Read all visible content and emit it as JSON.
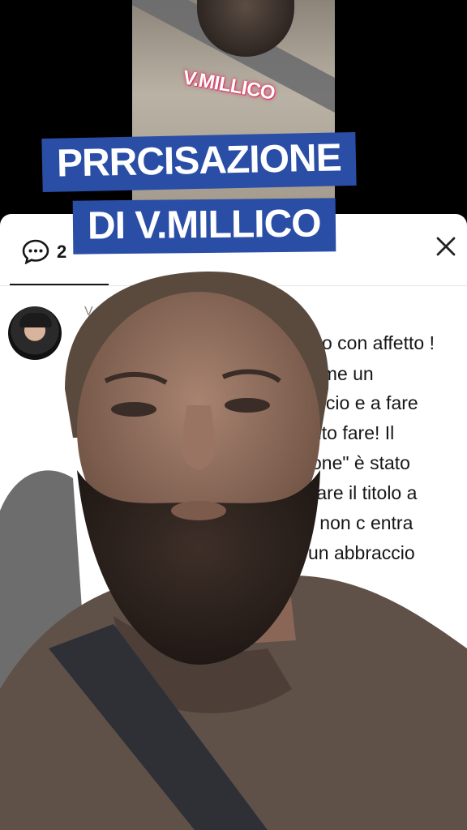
{
  "overlay": {
    "watermark": "V.MILLICO",
    "title_line1": "PRRCISAZIONE",
    "title_line2": "DI V.MILLICO"
  },
  "comments_sheet": {
    "count": "2",
    "username": "V",
    "comment_lines": [
      "o con affetto !",
      "ome un",
      "alcio e a fare",
      "uto fare! Il",
      "one\" è stato",
      "fare il titolo a",
      "di non c entra",
      "un abbraccio"
    ],
    "icons": {
      "comments": "speech-bubble-icon",
      "close": "close-icon"
    }
  },
  "colors": {
    "title_background": "#2a4ea6",
    "watermark_glow": "#e0406a"
  }
}
